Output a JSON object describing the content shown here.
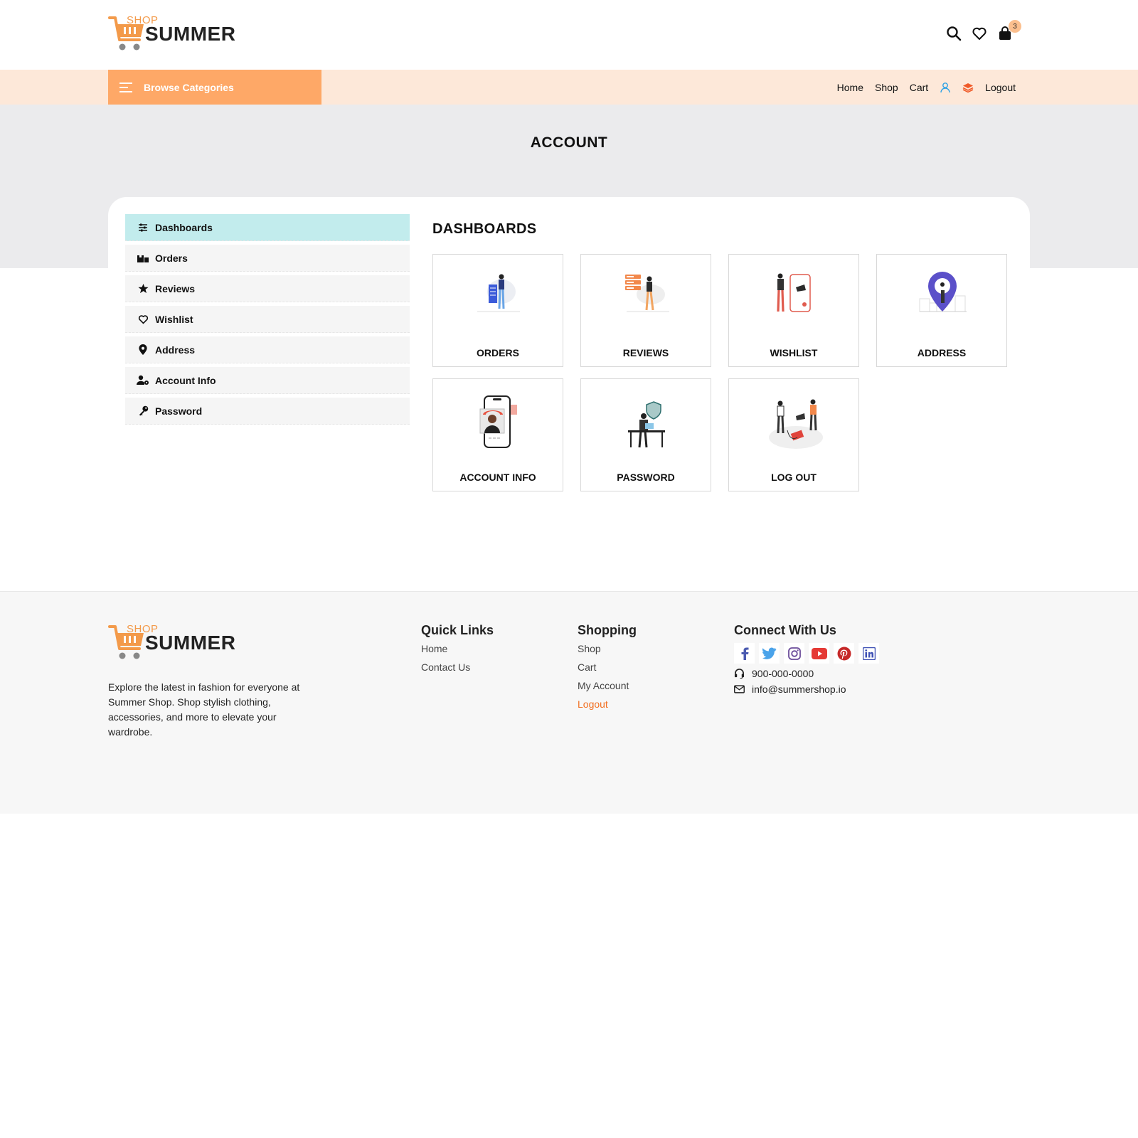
{
  "brand": {
    "shop": "SHOP",
    "name": "SUMMER"
  },
  "header": {
    "cart_count": "3"
  },
  "navbar": {
    "browse_label": "Browse Categories",
    "links": {
      "home": "Home",
      "shop": "Shop",
      "cart": "Cart",
      "logout": "Logout"
    }
  },
  "banner": {
    "title": "ACCOUNT"
  },
  "sidebar": {
    "items": [
      {
        "label": "Dashboards"
      },
      {
        "label": "Orders"
      },
      {
        "label": "Reviews"
      },
      {
        "label": "Wishlist"
      },
      {
        "label": "Address"
      },
      {
        "label": "Account Info"
      },
      {
        "label": "Password"
      }
    ]
  },
  "dashboard": {
    "title": "DASHBOARDS",
    "tiles": [
      {
        "label": "ORDERS"
      },
      {
        "label": "REVIEWS"
      },
      {
        "label": "WISHLIST"
      },
      {
        "label": "ADDRESS"
      },
      {
        "label": "ACCOUNT INFO"
      },
      {
        "label": "PASSWORD"
      },
      {
        "label": "LOG OUT"
      }
    ]
  },
  "footer": {
    "description": "Explore the latest in fashion for everyone at Summer Shop. Shop stylish clothing, accessories, and more to elevate your wardrobe.",
    "quick_links": {
      "title": "Quick Links",
      "items": [
        "Home",
        "Contact Us"
      ]
    },
    "shopping": {
      "title": "Shopping",
      "items": [
        "Shop",
        "Cart",
        "My Account",
        "Logout"
      ]
    },
    "connect": {
      "title": "Connect With Us",
      "phone": "900-000-0000",
      "email": "info@summershop.io"
    }
  },
  "colors": {
    "accent_orange": "#fea867",
    "nav_bg": "#fde8d9",
    "active_item": "#c2eced",
    "logout_link": "#f26f21"
  }
}
